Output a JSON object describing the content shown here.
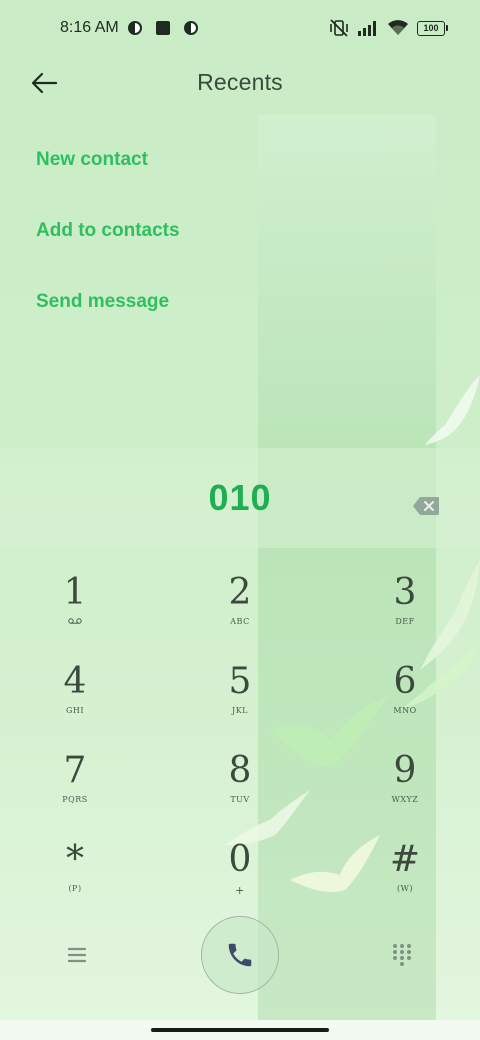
{
  "status_bar": {
    "time": "8:16 AM",
    "battery": "100",
    "icons": [
      "notification-app-icon",
      "notification-square-icon",
      "notification-app-icon",
      "vibrate-muted-icon",
      "signal-icon",
      "wifi-icon",
      "battery-icon"
    ]
  },
  "header": {
    "title": "Recents",
    "back_icon": "back-arrow-icon"
  },
  "menu": {
    "items": [
      {
        "label": "New contact"
      },
      {
        "label": "Add to contacts"
      },
      {
        "label": "Send message"
      }
    ]
  },
  "dialer": {
    "number": "010",
    "backspace_icon": "backspace-icon"
  },
  "keypad": {
    "keys": [
      {
        "digit": "1",
        "letters": "ᅟ"
      },
      {
        "digit": "2",
        "letters": "ABC"
      },
      {
        "digit": "3",
        "letters": "DEF"
      },
      {
        "digit": "4",
        "letters": "GHI"
      },
      {
        "digit": "5",
        "letters": "JKL"
      },
      {
        "digit": "6",
        "letters": "MNO"
      },
      {
        "digit": "7",
        "letters": "PQRS"
      },
      {
        "digit": "8",
        "letters": "TUV"
      },
      {
        "digit": "9",
        "letters": "WXYZ"
      },
      {
        "digit": "*",
        "letters": "(P)"
      },
      {
        "digit": "0",
        "letters": "+"
      },
      {
        "digit": "#",
        "letters": "(W)"
      }
    ]
  },
  "bottom_bar": {
    "menu_icon": "hamburger-menu-icon",
    "call_icon": "phone-icon",
    "dialpad_icon": "dialpad-icon"
  },
  "colors": {
    "accent": "#2fbf5f",
    "number": "#1fae52",
    "background": "#cdeec9"
  }
}
